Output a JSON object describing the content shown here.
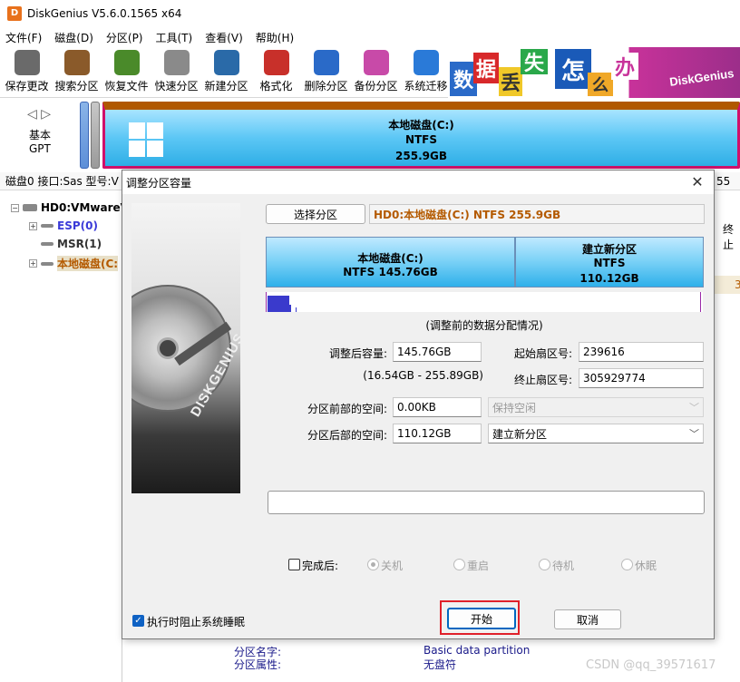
{
  "app": {
    "title": "DiskGenius V5.6.0.1565 x64",
    "logo_letter": "D"
  },
  "menu": [
    "文件(F)",
    "磁盘(D)",
    "分区(P)",
    "工具(T)",
    "查看(V)",
    "帮助(H)"
  ],
  "toolbar": [
    {
      "label": "保存更改",
      "icon": "save-disk-icon",
      "color": "#6a6a6a"
    },
    {
      "label": "搜索分区",
      "icon": "magnifier-icon",
      "color": "#8a5a2a"
    },
    {
      "label": "恢复文件",
      "icon": "recover-box-icon",
      "color": "#4a8a2a"
    },
    {
      "label": "快速分区",
      "icon": "quick-partition-icon",
      "color": "#8a8a8a"
    },
    {
      "label": "新建分区",
      "icon": "new-partition-icon",
      "color": "#2a6aa8"
    },
    {
      "label": "格式化",
      "icon": "format-icon",
      "color": "#c8302a"
    },
    {
      "label": "删除分区",
      "icon": "trash-icon",
      "color": "#2a6ac8"
    },
    {
      "label": "备份分区",
      "icon": "backup-icon",
      "color": "#c84aa8"
    },
    {
      "label": "系统迁移",
      "icon": "migrate-icon",
      "color": "#2a7ad8"
    }
  ],
  "banner": {
    "tiles": [
      "数",
      "据",
      "丢",
      "失",
      "怎",
      "么",
      "办"
    ],
    "brand": "DiskGenius"
  },
  "diskmap": {
    "type_line1": "基本",
    "type_line2": "GPT",
    "partition_name": "本地磁盘(C:)",
    "partition_fs": "NTFS",
    "partition_size": "255.9GB"
  },
  "disk_info": {
    "text": "磁盘0 接口:Sas  型号:V",
    "right_text": "55"
  },
  "tree": {
    "disk": "HD0:VMwareV",
    "items": [
      {
        "label": "ESP(0)",
        "color": "#3a3ad8"
      },
      {
        "label": "MSR(1)",
        "color": "#333333"
      },
      {
        "label": "本地磁盘(C:",
        "color": "#b45a00"
      }
    ]
  },
  "right_peek": {
    "col": "终止",
    "val": "3"
  },
  "bottom_info": {
    "rows": [
      {
        "label": "分区名字:",
        "value": "Basic data partition"
      },
      {
        "label": "分区属性:",
        "value": "无盘符"
      }
    ]
  },
  "dialog": {
    "title": "调整分区容量",
    "close_symbol": "✕",
    "select_button": "选择分区",
    "partition_path": "HD0:本地磁盘(C:) NTFS 255.9GB",
    "brand": "DISKGENIUS",
    "bars": [
      {
        "name": "本地磁盘(C:)",
        "detail": "NTFS 145.76GB"
      },
      {
        "name": "建立新分区",
        "detail": "NTFS",
        "size": "110.12GB"
      }
    ],
    "caption": "(调整前的数据分配情况)",
    "fields": {
      "size_label": "调整后容量:",
      "size_value": "145.76GB",
      "range": "(16.54GB - 255.89GB)",
      "start_label": "起始扇区号:",
      "start_value": "239616",
      "end_label": "终止扇区号:",
      "end_value": "305929774",
      "before_label": "分区前部的空间:",
      "before_value": "0.00KB",
      "before_action": "保持空闲",
      "after_label": "分区后部的空间:",
      "after_value": "110.12GB",
      "after_action": "建立新分区"
    },
    "progress_percent": 0,
    "after_complete": {
      "label": "完成后:",
      "options": [
        "关机",
        "重启",
        "待机",
        "休眠"
      ],
      "selected_index": 0
    },
    "prevent_sleep": "执行时阻止系统睡眠",
    "start_button": "开始",
    "cancel_button": "取消",
    "colors": {
      "highlight": "#e0202a",
      "path_text": "#b45a00"
    }
  },
  "watermark": "CSDN @qq_39571617"
}
